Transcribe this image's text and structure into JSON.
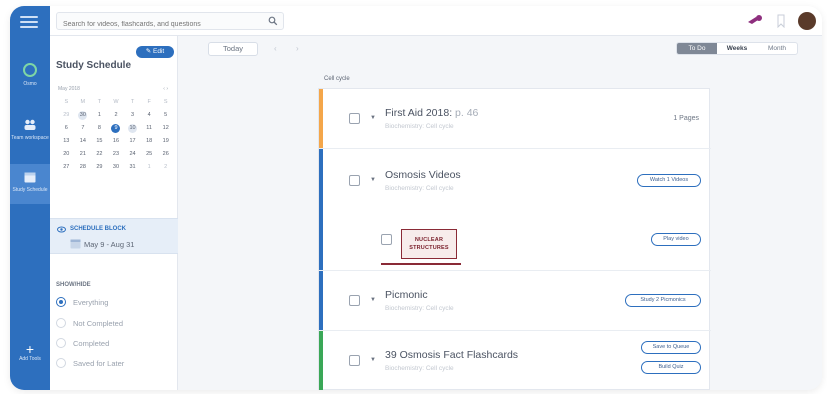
{
  "search": {
    "placeholder": "Search for videos, flashcards, and questions"
  },
  "rail": {
    "items": [
      {
        "label": "Osmo"
      },
      {
        "label": "Team workspace"
      },
      {
        "label": "Study Schedule"
      }
    ],
    "add_tools": "Add Tools"
  },
  "panel": {
    "title": "Study Schedule",
    "edit_label": "✎ Edit",
    "calendar": {
      "month": "May 2018",
      "nav": "‹ ›",
      "weekdays": [
        "S",
        "M",
        "T",
        "W",
        "T",
        "F",
        "S"
      ],
      "rows": [
        [
          "29",
          "30",
          "1",
          "2",
          "3",
          "4",
          "5"
        ],
        [
          "6",
          "7",
          "8",
          "9",
          "10",
          "11",
          "12"
        ],
        [
          "13",
          "14",
          "15",
          "16",
          "17",
          "18",
          "19"
        ],
        [
          "20",
          "21",
          "22",
          "23",
          "24",
          "25",
          "26"
        ],
        [
          "27",
          "28",
          "29",
          "30",
          "31",
          "1",
          "2"
        ]
      ]
    },
    "schedule_block": {
      "label": "SCHEDULE BLOCK",
      "dates": "May 9 - Aug 31"
    },
    "show_hide": {
      "label": "SHOW/HIDE",
      "options": [
        "Everything",
        "Not Completed",
        "Completed",
        "Saved for Later"
      ]
    }
  },
  "main": {
    "today_label": "Today",
    "views": [
      "To Do",
      "Weeks",
      "Month"
    ],
    "day_label": "Cell cycle",
    "tasks": [
      {
        "title": "First Aid 2018:",
        "page": "p. 46",
        "sub": "Biochemistry: Cell cycle",
        "right": "1 Pages",
        "color": "#f4a64a"
      },
      {
        "title": "Osmosis Videos",
        "sub": "Biochemistry: Cell cycle",
        "pill": "Watch 1 Videos",
        "color": "#2d6fbe"
      },
      {
        "thumb": "NUCLEAR STRUCTURES",
        "pill": "Play video",
        "color": "#2d6fbe"
      },
      {
        "title": "Picmonic",
        "sub": "Biochemistry: Cell cycle",
        "pill": "Study 2 Picmonics",
        "color": "#2d6fbe"
      },
      {
        "title": "39 Osmosis Fact Flashcards",
        "sub": "Biochemistry: Cell cycle",
        "pill": "Save to Queue",
        "pill2": "Build Quiz",
        "color": "#3aa757"
      }
    ]
  },
  "colors": {
    "accent": "#2d6fbe",
    "rail": "#2d6fbe",
    "fa_bar": "#f4a64a",
    "flash_bar": "#3aa757"
  }
}
